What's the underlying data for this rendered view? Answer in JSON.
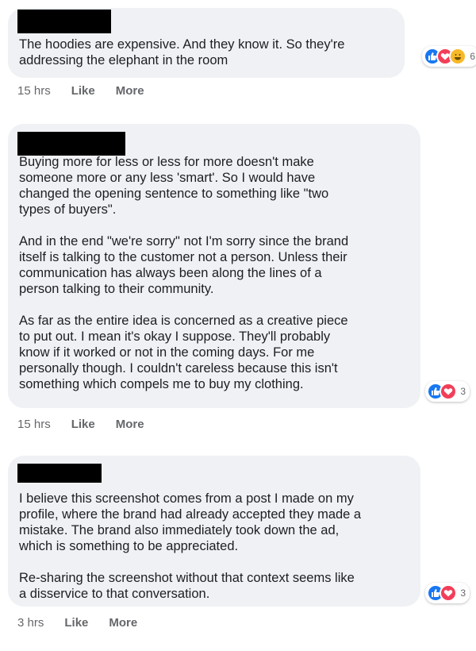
{
  "comments": [
    {
      "paragraphs": [
        "The hoodies are expensive. And they know it. So they're\naddressing the elephant in the room"
      ],
      "reaction_count": "6",
      "reactions": [
        "like-icon",
        "love-icon",
        "haha-icon"
      ],
      "time": "15 hrs",
      "like_label": "Like",
      "more_label": "More"
    },
    {
      "paragraphs": [
        "Buying more for less or less for more doesn't make\nsomeone more or any less 'smart'. So I would have\nchanged the opening sentence to something like \"two\ntypes of buyers\".",
        "And in the end \"we're sorry\" not I'm sorry since the brand\nitself is talking to the customer not a person. Unless their\ncommunication has always been along the lines of a\nperson talking to their community.",
        "As far as the entire idea is concerned as a creative piece\nto put out. I mean it's okay I suppose. They'll probably\nknow if it worked or not in the coming days. For me\npersonally though. I couldn't careless because this isn't\nsomething which compels me to buy my clothing."
      ],
      "reaction_count": "3",
      "reactions": [
        "like-icon",
        "love-icon"
      ],
      "time": "15 hrs",
      "like_label": "Like",
      "more_label": "More"
    },
    {
      "paragraphs": [
        "I believe this screenshot comes from a post I made on my\nprofile, where the brand had already accepted they made a\nmistake. The brand also immediately took down the ad,\nwhich is something to be appreciated.",
        "Re-sharing the screenshot without that context seems like\na disservice to that conversation."
      ],
      "reaction_count": "3",
      "reactions": [
        "like-icon",
        "love-icon"
      ],
      "time": "3 hrs",
      "like_label": "Like",
      "more_label": "More"
    }
  ],
  "colors": {
    "bubble": "#eff1f4",
    "like": "#1877f2",
    "love": "#f33e58",
    "haha": "#f7b928",
    "meta": "#65676b"
  }
}
